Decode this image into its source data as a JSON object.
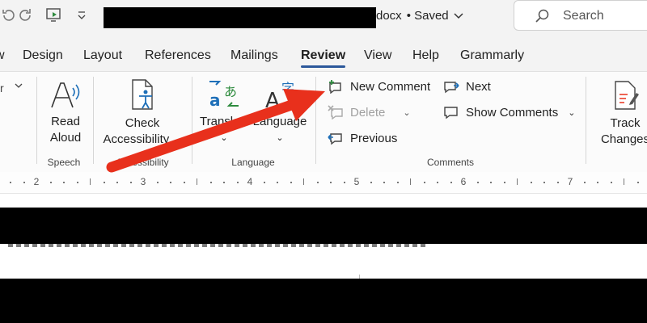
{
  "titlebar": {
    "filename_suffix": "docx",
    "saved_label": "• Saved",
    "search_placeholder": "Search"
  },
  "tabs": [
    {
      "label": "w"
    },
    {
      "label": "Design"
    },
    {
      "label": "Layout"
    },
    {
      "label": "References"
    },
    {
      "label": "Mailings"
    },
    {
      "label": "Review",
      "active": true
    },
    {
      "label": "View"
    },
    {
      "label": "Help"
    },
    {
      "label": "Grammarly"
    }
  ],
  "ribbon": {
    "read_aloud": {
      "line1": "Read",
      "line2": "Aloud"
    },
    "check_accessibility": {
      "line1": "Check",
      "line2": "Accessibility"
    },
    "translate": {
      "label": "Translate"
    },
    "language": {
      "label": "Language"
    },
    "comments": {
      "new_comment": "New Comment",
      "delete": "Delete",
      "previous": "Previous",
      "next": "Next",
      "show_comments": "Show Comments"
    },
    "track_changes": {
      "line1": "Track",
      "line2": "Changes"
    },
    "groups": {
      "speech": "Speech",
      "accessibility": "Accessibility",
      "language": "Language",
      "comments": "Comments"
    }
  },
  "ruler": {
    "numbers": [
      "2",
      "3",
      "4",
      "5",
      "6",
      "7"
    ]
  },
  "colors": {
    "accent": "#2b579a",
    "arrow": "#e8301c",
    "green": "#4caf50",
    "blue": "#1e6fb8"
  }
}
